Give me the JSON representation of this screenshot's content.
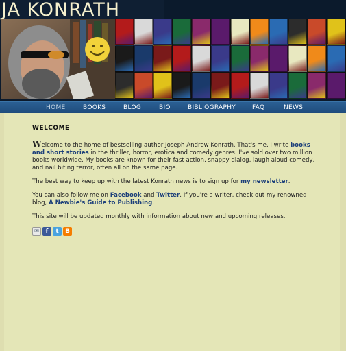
{
  "site_title": "JA KONRATH",
  "nav": [
    "HOME",
    "BOOKS",
    "BLOG",
    "BIO",
    "BIBLIOGRAPHY",
    "FAQ",
    "NEWS"
  ],
  "content": {
    "heading": "WELCOME",
    "p1_dropcap": "W",
    "p1_a": "elcome to the home of bestselling author Joseph Andrew Konrath. That's me. I write ",
    "p1_link": "books and short stories",
    "p1_b": " in the thriller, horror, erotica and comedy genres. I've sold over two million books worldwide. My books are known for their fast action, snappy dialog, laugh aloud comedy, and nail biting terror, often all on the same page.",
    "p2_a": "The best way to keep up with the latest Konrath news is to sign up for ",
    "p2_link": "my newsletter",
    "p2_b": ".",
    "p3_a": "You can also follow me on ",
    "p3_link1": "Facebook",
    "p3_mid": " and ",
    "p3_link2": "Twitter",
    "p3_b": ". If you're a writer, check out my renowned blog, ",
    "p3_link3": "A Newbie's Guide to Publishing",
    "p3_c": ".",
    "p4": "This site will be updated monthly with information about new and upcoming releases."
  },
  "share_icons": [
    "email-icon",
    "facebook-icon",
    "twitter-icon",
    "blogger-icon"
  ],
  "colors": {
    "nav": "#1f4c7c",
    "background": "#dedeb0",
    "link": "#1c3f7a"
  }
}
